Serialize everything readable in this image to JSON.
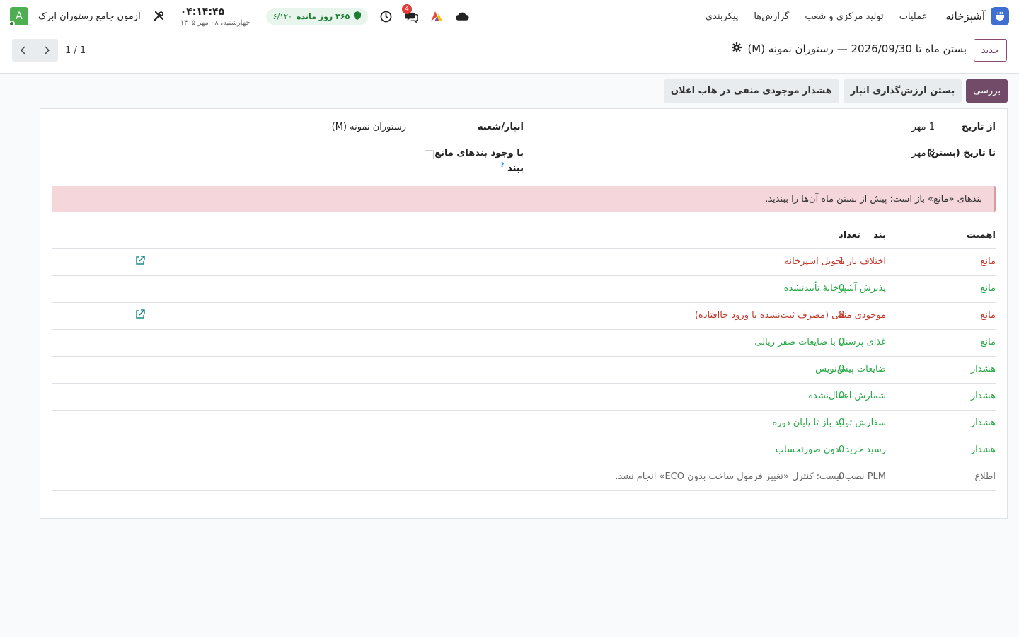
{
  "navbar": {
    "brand_label": "آشپزخانه",
    "menu": [
      "عملیات",
      "تولید مرکزی و شعب",
      "گزارش‌ها",
      "پیکربندی"
    ],
    "subscription": {
      "days_left": "۳۶۵ روز مانده",
      "count": "۶/۱۲۰"
    },
    "chat_badge": "4",
    "clock": {
      "time": "۰۴:۱۴:۴۵",
      "date": "چهارشنبه، ۰۸ مهر ۱۴۰۵"
    },
    "company": "آزمون جامع رستوران ابرک",
    "avatar_letter": "A",
    "icons": [
      "cloud-icon",
      "app-logo-icon",
      "chat-icon",
      "clock-icon",
      "shield-icon",
      "tools-icon"
    ]
  },
  "control": {
    "new_button": "جدید",
    "record_title": "بستن ماه تا 2026/09/30 — رستوران نمونه (M)",
    "pager": "1 / 1"
  },
  "status_buttons": {
    "review": "بررسی",
    "close_valuation": "بستن ارزش‌گذاری انبار",
    "negative_alert": "هشدار موجودی منفی در هاب اعلان"
  },
  "form": {
    "from_date_label": "از تاریخ",
    "from_date_value": "1 مهر",
    "to_date_label": "تا تاریخ (بستن)",
    "to_date_value": "8 مهر",
    "warehouse_label": "انبار/شعبه",
    "warehouse_value": "رستوران نمونه (M)",
    "blocking_label_1": "با وجود بندهای مانع",
    "blocking_label_2": "ببند",
    "help_mark": "?",
    "alert": "بندهای «مانع» باز است؛ پیش از بستن ماه آن‌ها را ببندید."
  },
  "table": {
    "headers": {
      "severity": "اهمیت",
      "item": "بند",
      "count": "تعداد"
    },
    "rows": [
      {
        "severity": "مانع",
        "item": "اختلاف باز تحویل آشپزخانه",
        "count": "1",
        "status": "red",
        "link": true
      },
      {
        "severity": "مانع",
        "item": "پذیرش آشپزخانهٔ تأییدنشده",
        "count": "0",
        "status": "green",
        "link": false
      },
      {
        "severity": "مانع",
        "item": "موجودی منفی (مصرف ثبت‌نشده یا ورود جاافتاده)",
        "count": "8",
        "status": "red",
        "link": true
      },
      {
        "severity": "مانع",
        "item": "غذای پرسنل با ضایعات صفر ریالی",
        "count": "0",
        "status": "green",
        "link": false
      },
      {
        "severity": "هشدار",
        "item": "ضایعات پیش‌نویس",
        "count": "0",
        "status": "green",
        "link": false
      },
      {
        "severity": "هشدار",
        "item": "شمارش اعمال‌نشده",
        "count": "0",
        "status": "green",
        "link": false
      },
      {
        "severity": "هشدار",
        "item": "سفارش تولید باز تا پایان دوره",
        "count": "0",
        "status": "green",
        "link": false
      },
      {
        "severity": "هشدار",
        "item": "رسید خرید بدون صورتحساب",
        "count": "0",
        "status": "green",
        "link": false
      },
      {
        "severity": "اطلاع",
        "item": "PLM نصب نیست؛ کنترل «تغییر فرمول ساخت بدون ECO» انجام نشد.",
        "count": "0",
        "status": "grey",
        "link": false
      }
    ]
  },
  "colors": {
    "primary": "#714b67",
    "danger_alert_bg": "#f5d7db",
    "red": "#c0392b",
    "green": "#28a745",
    "brand_blue": "#3f6fd1"
  }
}
